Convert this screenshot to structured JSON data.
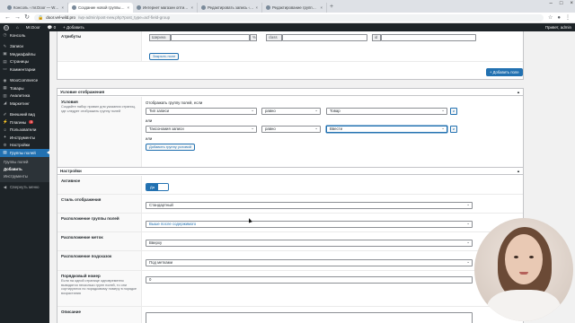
{
  "browser": {
    "tabs": [
      {
        "title": "Консоль ‹ mr.Door — WordPre…"
      },
      {
        "title": "Создание новой группы полей…"
      },
      {
        "title": "Интернет магазин оптики mi…"
      },
      {
        "title": "Редактировать запись ‹ Mr.D…"
      },
      {
        "title": "Редактирование группы полей…"
      }
    ],
    "active_tab": 1,
    "url_host": "door.vel-wild.pro",
    "url_path": "/wp-admin/post-new.php?post_type=acf-field-group"
  },
  "adminbar": {
    "site_name": "Mr.Door",
    "comments_count": "0",
    "new_label": "+ Добавить",
    "greeting": "Привет, admin"
  },
  "sidebar": {
    "items": [
      {
        "label": "Консоль",
        "icon": "dashboard-icon"
      },
      {
        "label": "Записи",
        "icon": "pin-icon"
      },
      {
        "label": "Медиафайлы",
        "icon": "media-icon"
      },
      {
        "label": "Страницы",
        "icon": "page-icon"
      },
      {
        "label": "Комментарии",
        "icon": "comment-icon"
      },
      {
        "label": "WooCommerce",
        "icon": "woo-icon"
      },
      {
        "label": "Товары",
        "icon": "box-icon"
      },
      {
        "label": "Аналитика",
        "icon": "chart-icon"
      },
      {
        "label": "Маркетинг",
        "icon": "megaphone-icon"
      },
      {
        "label": "Внешний вид",
        "icon": "brush-icon"
      },
      {
        "label": "Плагины",
        "icon": "plugin-icon",
        "badge": "4"
      },
      {
        "label": "Пользователи",
        "icon": "user-icon"
      },
      {
        "label": "Инструменты",
        "icon": "wrench-icon"
      },
      {
        "label": "Настройки",
        "icon": "settings-icon"
      },
      {
        "label": "Группы полей",
        "icon": "fields-icon"
      }
    ],
    "submenu": [
      "Группы полей",
      "Добавить",
      "Инструменты"
    ],
    "collapse": "Свернуть меню"
  },
  "attributes_row": {
    "label": "Атрибуты",
    "width_label": "Ширина",
    "percent": "%",
    "class_label": "class",
    "id_label": "id",
    "close_field": "Закрыть поле",
    "add_field": "+ Добавить поле"
  },
  "location": {
    "title": "Условие отображения",
    "label": "Условия",
    "desc": "Создайте набор правил для указания страниц, где следует отображать группу полей",
    "show_if": "Отображать группу полей, если",
    "rule1": {
      "param": "Тип записи",
      "operator": "равно",
      "value": "Товар",
      "and": "и"
    },
    "or1": "или",
    "rule2": {
      "param": "Таксономия записи",
      "operator": "равно",
      "value": "Ввести",
      "and": "и"
    },
    "or2": "или",
    "add_group": "Добавить группу условий"
  },
  "settings": {
    "title": "Настройки",
    "active_label": "Активное",
    "active_toggle": "Да",
    "style_label": "Стиль отображения",
    "style_value": "Стандартный",
    "position_label": "Расположение группы полей",
    "position_value": "Выше после содержимого",
    "label_placement_label": "Расположение меток",
    "label_placement_value": "Вверху",
    "instruction_label": "Расположение подсказок",
    "instruction_value": "Под метками",
    "order_label": "Порядковый номер",
    "order_desc": "Если на одной странице одновременно выводятся несколько групп полей, то они сортируются по порядковому номеру в порядке возрастания",
    "order_value": "0",
    "description_label": "Описание"
  },
  "colors": {
    "accent": "#2271b1",
    "admin_bg": "#1d2327",
    "badge": "#d63638"
  }
}
